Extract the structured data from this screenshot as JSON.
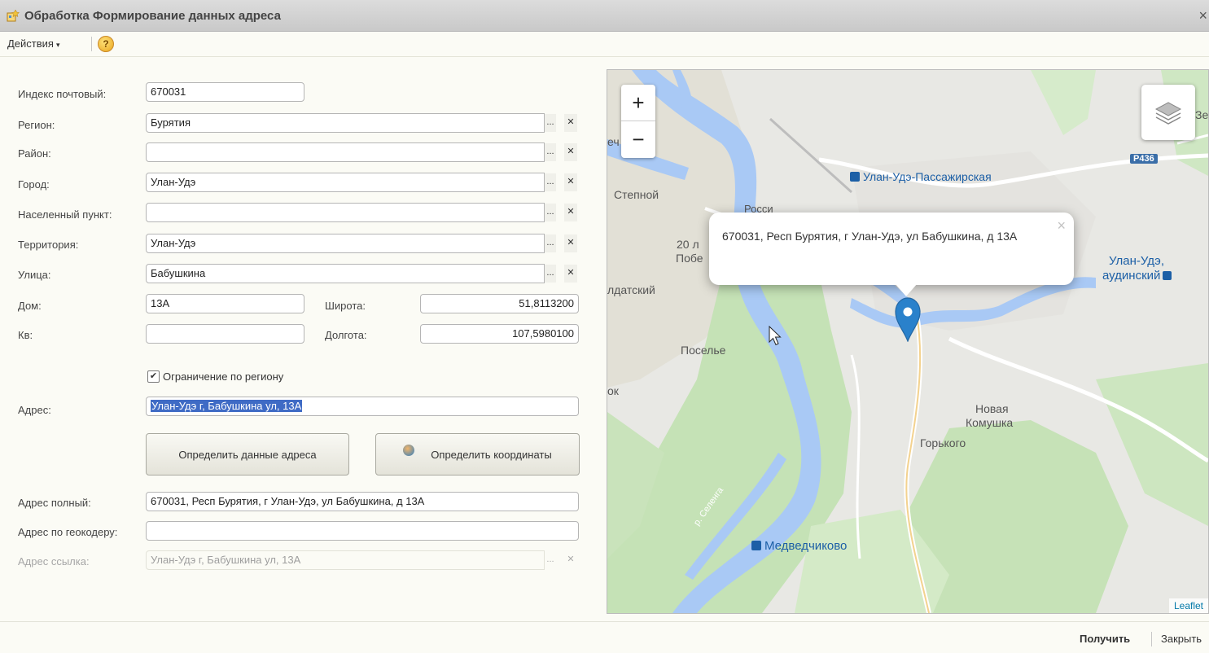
{
  "window": {
    "title": "Обработка  Формирование данных адреса",
    "close_glyph": "×"
  },
  "toolbar": {
    "actions_label": "Действия",
    "actions_arrow": "▾",
    "help_glyph": "?"
  },
  "form": {
    "index_label": "Индекс почтовый:",
    "index_value": "670031",
    "region_label": "Регион:",
    "region_value": "Бурятия",
    "district_label": "Район:",
    "district_value": "",
    "city_label": "Город:",
    "city_value": "Улан-Удэ",
    "settlement_label": "Населенный пункт:",
    "settlement_value": "",
    "territory_label": "Территория:",
    "territory_value": "Улан-Удэ",
    "street_label": "Улица:",
    "street_value": "Бабушкина",
    "house_label": "Дом:",
    "house_value": "13А",
    "apt_label": "Кв:",
    "apt_value": "",
    "lat_label": "Широта:",
    "lat_value": "51,8113200",
    "lon_label": "Долгота:",
    "lon_value": "107,5980100",
    "restrict_label": "Ограничение по региону",
    "restrict_checked": "✔",
    "address_label": "Адрес:",
    "address_value": "Улан-Удэ г, Бабушкина ул, 13А",
    "btn_define_address": "Определить данные адреса",
    "btn_define_coords": "Определить координаты",
    "full_label": "Адрес полный:",
    "full_value": "670031, Респ Бурятия, г Улан-Удэ, ул Бабушкина, д 13А",
    "geocoder_label": "Адрес по геокодеру:",
    "geocoder_value": "",
    "link_label": "Адрес ссылка:",
    "link_value": "Улан-Удэ г, Бабушкина ул, 13А",
    "choose_glyph": "...",
    "clear_glyph": "✕"
  },
  "map": {
    "zoom_in": "+",
    "zoom_out": "−",
    "popup_text": "670031, Респ Бурятия, г Улан-Удэ, ул Бабушкина, д 13А",
    "popup_close": "×",
    "attribution": "Leaflet",
    "labels": {
      "stepnoy": "Степной",
      "station": "Улан-Удэ-Пассажирская",
      "r436": "Р436",
      "ze": "Зе",
      "ech": "еч",
      "rossiya": "Росси",
      "num20": "20 л",
      "pobe": "Побе",
      "soldatskiy": "лдатский",
      "ulan_ude2": "Улан-Удэ,",
      "audinskiy": "аудинский",
      "poselye": "Поселье",
      "ok": "ок",
      "novaya": "Новая",
      "komushka": "Комушка",
      "gorkogo": "Горького",
      "selenga": "р. Селенга",
      "medvedchikovo": "Медведчиково"
    },
    "colors": {
      "marker": "#2a81cb",
      "water": "#a9c9f5",
      "forest": "#c3e1b3",
      "urban": "#e7e6e2"
    }
  },
  "footer": {
    "get_label": "Получить",
    "close_label": "Закрыть"
  }
}
